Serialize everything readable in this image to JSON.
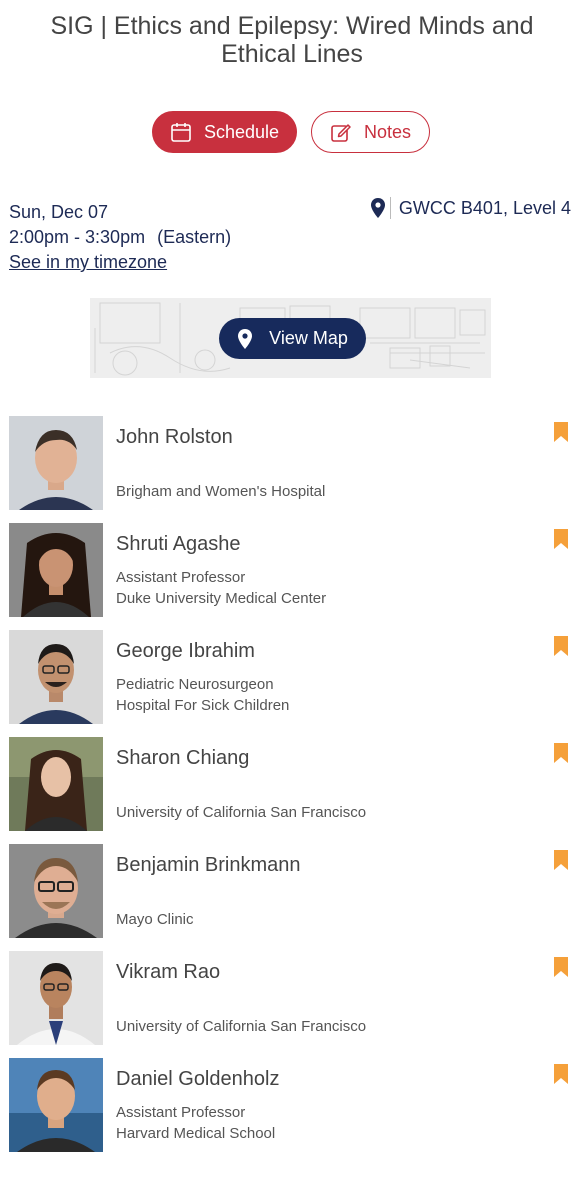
{
  "session": {
    "title": "SIG | Ethics and Epilepsy: Wired Minds and Ethical Lines"
  },
  "actions": {
    "schedule_label": "Schedule",
    "notes_label": "Notes"
  },
  "time": {
    "date": "Sun, Dec 07",
    "range": "2:00pm - 3:30pm",
    "zone": "(Eastern)",
    "timezone_link": "See in my timezone"
  },
  "location": {
    "label": "GWCC B401, Level 4"
  },
  "map": {
    "button_label": "View Map"
  },
  "colors": {
    "accent_red": "#c8303e",
    "navy": "#1d2a55",
    "bookmark_orange": "#f5a03a"
  },
  "speakers": [
    {
      "name": "John Rolston",
      "title": "",
      "org": "Brigham and Women's Hospital"
    },
    {
      "name": "Shruti Agashe",
      "title": "Assistant Professor",
      "org": "Duke University Medical Center"
    },
    {
      "name": "George Ibrahim",
      "title": "Pediatric Neurosurgeon",
      "org": "Hospital For Sick Children"
    },
    {
      "name": "Sharon Chiang",
      "title": "",
      "org": "University of California San Francisco"
    },
    {
      "name": "Benjamin Brinkmann",
      "title": "",
      "org": "Mayo Clinic"
    },
    {
      "name": "Vikram Rao",
      "title": "",
      "org": "University of California San Francisco"
    },
    {
      "name": "Daniel Goldenholz",
      "title": "Assistant Professor",
      "org": "Harvard Medical School"
    }
  ]
}
